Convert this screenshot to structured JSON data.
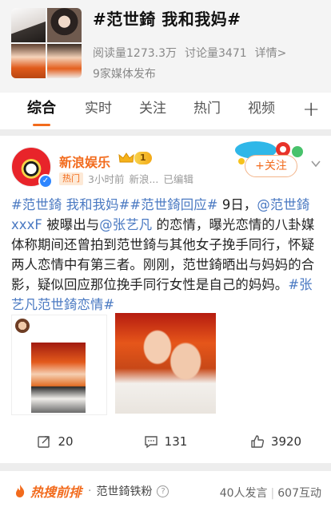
{
  "topic": {
    "title": "#范世錡 我和我妈#",
    "read_count": "阅读量1273.3万",
    "discussion_count": "讨论量3471",
    "details_link": "详情>",
    "media_count": "9家媒体发布"
  },
  "tabs": [
    {
      "label": "综合",
      "active": true
    },
    {
      "label": "实时",
      "active": false
    },
    {
      "label": "关注",
      "active": false
    },
    {
      "label": "热门",
      "active": false
    },
    {
      "label": "视频",
      "active": false
    }
  ],
  "post": {
    "author": "新浪娱乐",
    "level": "1",
    "hot_tag": "热门",
    "time": "3小时前",
    "source": "新浪...",
    "edited": "已编辑",
    "follow_label": "+关注",
    "text_parts": [
      {
        "text": "#范世錡 我和我妈##范世錡回应#",
        "link": true
      },
      {
        "text": " 9日，",
        "link": false
      },
      {
        "text": "@范世錡xxxF",
        "link": true
      },
      {
        "text": " 被曝出与",
        "link": false
      },
      {
        "text": "@张艺凡",
        "link": true
      },
      {
        "text": " 的恋情，曝光恋情的八卦媒体称期间还曾拍到范世錡与其他女子挽手同行，怀疑两人恋情中有第三者。刚刚，范世錡晒出与妈妈的合影，疑似回应那位挽手同行女性是自己的妈妈。",
        "link": false
      },
      {
        "text": "#张艺凡范世錡恋情#",
        "link": true
      }
    ],
    "actions": {
      "repost": "20",
      "comment": "131",
      "like": "3920"
    }
  },
  "hot_bar": {
    "title": "热搜前排",
    "group": "范世錡铁粉",
    "speakers": "40人发言",
    "interactions": "607互动"
  },
  "colors": {
    "accent": "#f26b1d",
    "link": "#4a79c2"
  }
}
